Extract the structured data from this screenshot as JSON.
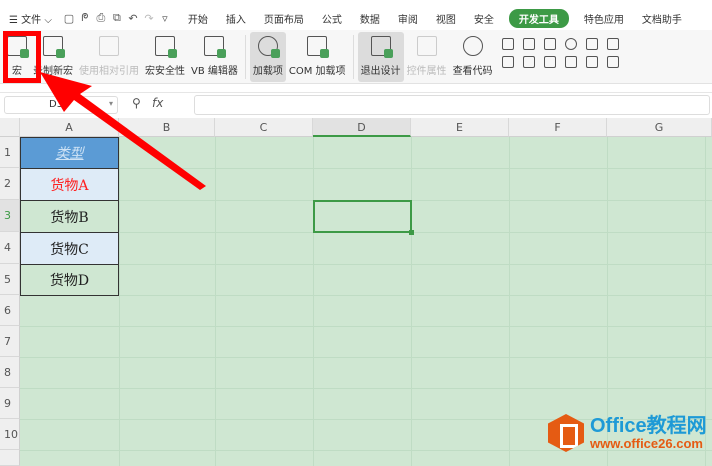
{
  "menubar": {
    "file": "文件",
    "tabs": [
      "开始",
      "插入",
      "页面布局",
      "公式",
      "数据",
      "审阅",
      "视图",
      "安全",
      "开发工具",
      "特色应用",
      "文档助手"
    ],
    "active_tab": "开发工具"
  },
  "ribbon": {
    "buttons": [
      "宏",
      "录制新宏",
      "使用相对引用",
      "宏安全性",
      "VB 编辑器",
      "加载项",
      "COM 加载项",
      "退出设计",
      "控件属性",
      "查看代码"
    ]
  },
  "formula_bar": {
    "name_box": "D3",
    "fx": "fx",
    "value": ""
  },
  "sheet": {
    "columns": [
      "A",
      "B",
      "C",
      "D",
      "E",
      "F",
      "G"
    ],
    "rows": [
      "1",
      "2",
      "3",
      "4",
      "5",
      "6",
      "7",
      "8",
      "9",
      "10"
    ],
    "cells": [
      "类型",
      "货物A",
      "货物B",
      "货物C",
      "货物D"
    ],
    "selected_cell": "D3"
  },
  "watermark": {
    "title": "Office教程网",
    "url": "www.office26.com"
  },
  "colors": {
    "accent": "#3d9a46",
    "header_fill": "#5b9bd5",
    "red": "#ff0000"
  }
}
